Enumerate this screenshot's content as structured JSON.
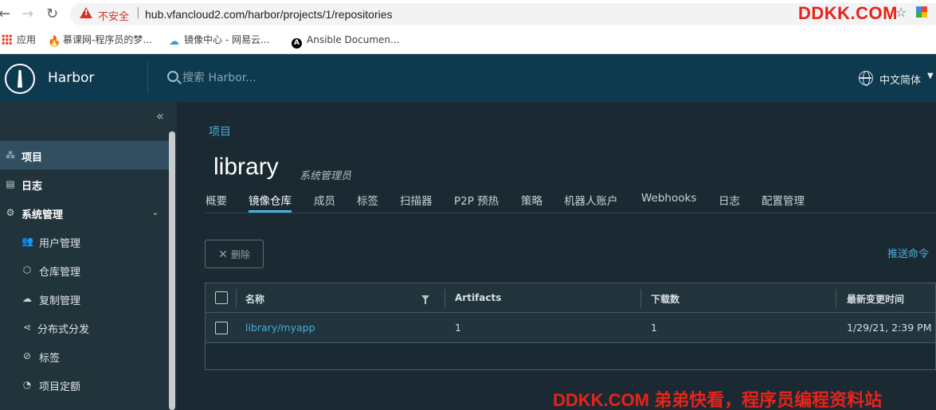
{
  "browser": {
    "insecure_label": "不安全",
    "url": "hub.vfancloud2.com/harbor/projects/1/repositories",
    "watermark": "DDKK.COM",
    "bookmarks": [
      {
        "label": "应用",
        "icon": "apps-grid-icon"
      },
      {
        "label": "慕课网-程序员的梦...",
        "icon": "imooc-icon"
      },
      {
        "label": "镜像中心 - 网易云...",
        "icon": "cloud-icon"
      },
      {
        "label": "Ansible Documen...",
        "icon": "ansible-icon"
      }
    ]
  },
  "header": {
    "brand": "Harbor",
    "search_placeholder": "搜索 Harbor...",
    "language": "中文简体"
  },
  "sidebar": {
    "items": [
      {
        "label": "项目",
        "icon": "projects-icon"
      },
      {
        "label": "日志",
        "icon": "logs-icon"
      },
      {
        "label": "系统管理",
        "icon": "admin-icon"
      },
      {
        "label": "用户管理",
        "icon": "users-icon"
      },
      {
        "label": "仓库管理",
        "icon": "registry-icon"
      },
      {
        "label": "复制管理",
        "icon": "replication-icon"
      },
      {
        "label": "分布式分发",
        "icon": "distribution-icon"
      },
      {
        "label": "标签",
        "icon": "tag-icon"
      },
      {
        "label": "项目定额",
        "icon": "quota-icon"
      }
    ]
  },
  "main": {
    "breadcrumb": "项目",
    "title": "library",
    "role": "系统管理员",
    "tabs": [
      "概要",
      "镜像仓库",
      "成员",
      "标签",
      "扫描器",
      "P2P 预热",
      "策略",
      "机器人账户",
      "Webhooks",
      "日志",
      "配置管理"
    ],
    "active_tab": "镜像仓库",
    "delete_label": "删除",
    "push_command": "推送命令",
    "table": {
      "columns": [
        "名称",
        "Artifacts",
        "下载数",
        "最新变更时间"
      ],
      "rows": [
        {
          "name": "library/myapp",
          "artifacts": "1",
          "pulls": "1",
          "updated": "1/29/21, 2:39 PM"
        }
      ]
    }
  },
  "footer_watermark": "DDKK.COM 弟弟快看，程序员编程资料站",
  "colors": {
    "header_bg": "#0d3a4e",
    "sidebar_bg": "#21333b",
    "main_bg": "#1b2a32",
    "accent": "#49afd9",
    "watermark": "#e8231a"
  }
}
